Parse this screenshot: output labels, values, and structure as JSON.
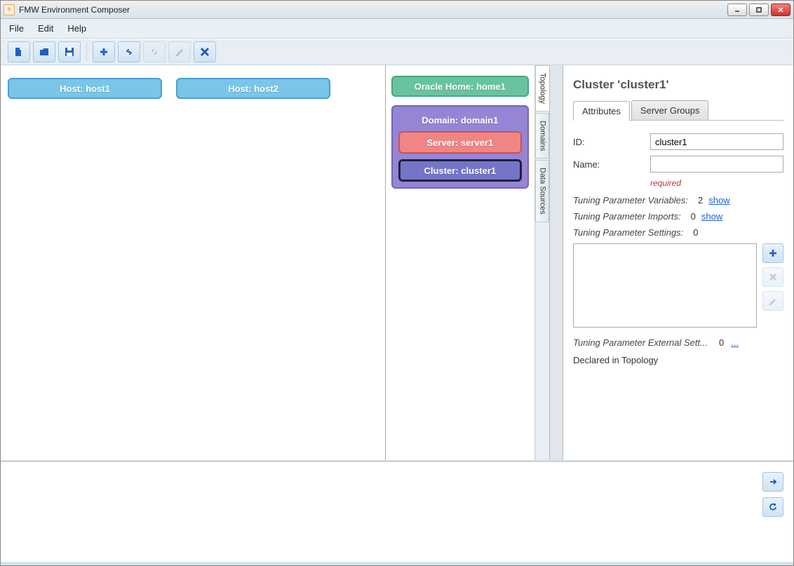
{
  "window": {
    "title": "FMW Environment Composer"
  },
  "menu": {
    "file": "File",
    "edit": "Edit",
    "help": "Help"
  },
  "hosts": [
    {
      "label": "Host: host1"
    },
    {
      "label": "Host: host2"
    }
  ],
  "oracle_home": {
    "label": "Oracle Home: home1"
  },
  "domain": {
    "label": "Domain: domain1",
    "server": "Server: server1",
    "cluster": "Cluster: cluster1"
  },
  "vtabs": {
    "topology": "Topology",
    "domains": "Domains",
    "datasources": "Data Sources"
  },
  "panel": {
    "title": "Cluster 'cluster1'",
    "tabs": {
      "attributes": "Attributes",
      "server_groups": "Server Groups"
    },
    "id_label": "ID:",
    "id_value": "cluster1",
    "name_label": "Name:",
    "name_value": "",
    "required": "required",
    "tpv_label": "Tuning Parameter Variables:",
    "tpv_count": "2",
    "tpv_link": "show",
    "tpi_label": "Tuning Parameter Imports:",
    "tpi_count": "0",
    "tpi_link": "show",
    "tps_label": "Tuning Parameter Settings:",
    "tps_count": "0",
    "tpe_label": "Tuning Parameter External Sett...",
    "tpe_count": "0",
    "tpe_link": "...",
    "declared": "Declared in Topology"
  }
}
